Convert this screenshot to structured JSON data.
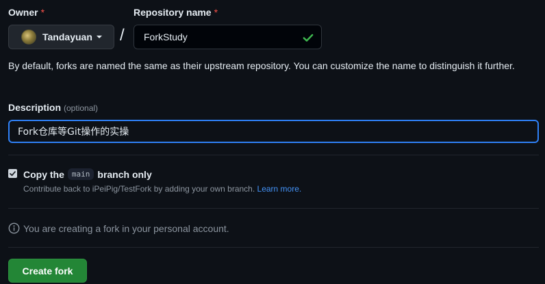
{
  "owner": {
    "label": "Owner",
    "required_mark": "*",
    "selected": "Tandayuan"
  },
  "repository": {
    "label": "Repository name",
    "required_mark": "*",
    "value": "ForkStudy",
    "separator": "/"
  },
  "hint_text": "By default, forks are named the same as their upstream repository. You can customize the name to distinguish it further.",
  "description": {
    "label": "Description",
    "optional": "(optional)",
    "value": "Fork仓库等Git操作的实操"
  },
  "copy_branch": {
    "checked": true,
    "label_before": "Copy the",
    "branch": "main",
    "label_after": "branch only",
    "sub_text": "Contribute back to iPeiPig/TestFork by adding your own branch.",
    "link": "Learn more."
  },
  "info_text": "You are creating a fork in your personal account.",
  "create_button": "Create fork",
  "colors": {
    "primary_button": "#238636",
    "focus_border": "#2f81f7",
    "required": "#f85149",
    "valid_check": "#3fb950",
    "link": "#4493f8"
  },
  "icons": [
    "avatar",
    "chevron-down-icon",
    "check-icon",
    "checkbox-check-icon",
    "info-icon"
  ]
}
